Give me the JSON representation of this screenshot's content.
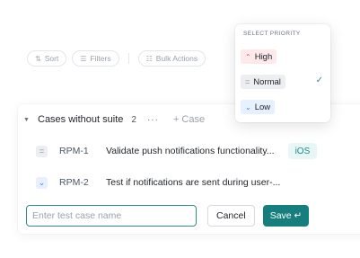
{
  "toolbar": {
    "sort_icon": "sort-icon",
    "sort_label": "Sort",
    "filters_icon": "filter-icon",
    "filters_label": "Filters",
    "bulk_icon": "list-icon",
    "bulk_label": "Bulk Actions"
  },
  "suite": {
    "title": "Cases without suite",
    "count": "2",
    "more": "···",
    "add_case": "+ Case"
  },
  "cases": [
    {
      "priority": "Normal",
      "priority_symbol": "=",
      "id": "RPM-1",
      "title": "Validate push notifications functionality...",
      "tag": "iOS"
    },
    {
      "priority": "Low",
      "priority_symbol": "⌄",
      "id": "RPM-2",
      "title": "Test if notifications are sent during user-..."
    }
  ],
  "form": {
    "input_value": "",
    "input_placeholder": "Enter test case name",
    "cancel_label": "Cancel",
    "save_label": "Save ↵"
  },
  "priority_menu": {
    "label": "SELECT PRIORITY",
    "options": [
      {
        "label": "High",
        "symbol": "⌃",
        "color": "#e0465a"
      },
      {
        "label": "Normal",
        "symbol": "=",
        "color": "#8a9099"
      },
      {
        "label": "Low",
        "symbol": "⌄",
        "color": "#3b82f6"
      }
    ],
    "selected": "Normal",
    "check": "✓"
  },
  "colors": {
    "accent": "#167f7d",
    "tag_bg": "#e8f6f5",
    "tag_text": "#1d8a86"
  }
}
